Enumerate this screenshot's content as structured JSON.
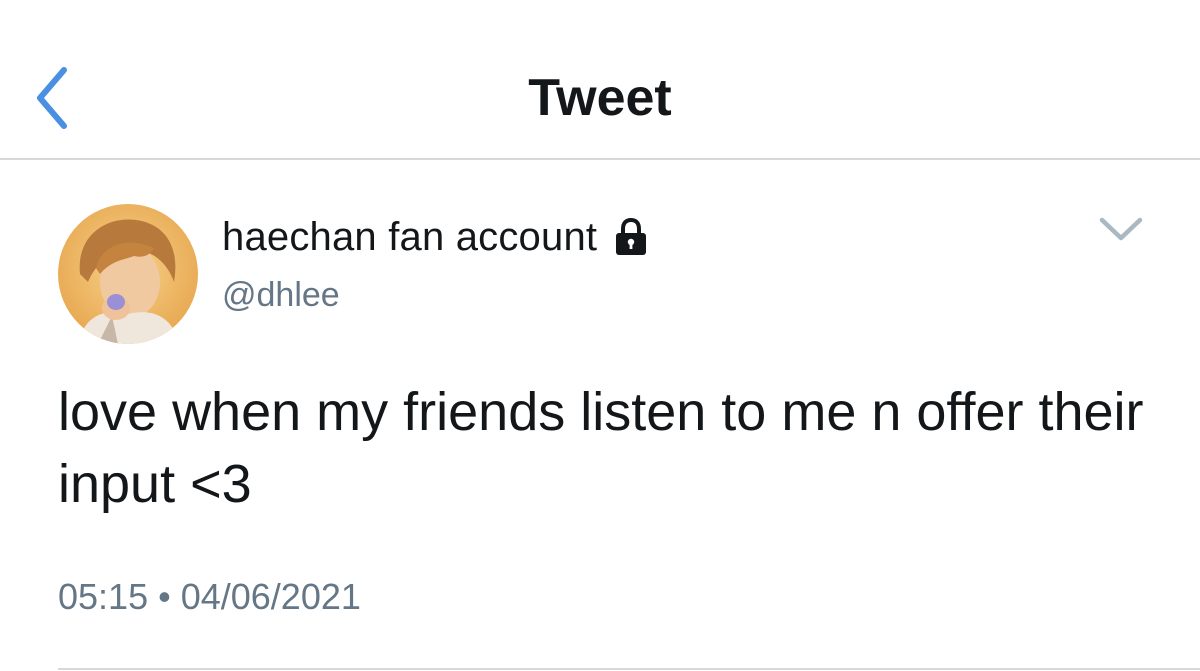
{
  "nav": {
    "title": "Tweet",
    "back_icon": "chevron-left-icon",
    "accent_color": "#4a90e2"
  },
  "tweet": {
    "author": {
      "display_name": "haechan fan account",
      "handle": "@dhlee",
      "protected_icon": "lock-icon"
    },
    "caret_icon": "chevron-down-icon",
    "text": "love when my friends listen to me n offer their input <3",
    "time": "05:15",
    "separator": "•",
    "date": "04/06/2021"
  },
  "colors": {
    "text_primary": "#14171a",
    "text_secondary": "#657786",
    "divider": "#d6d9dc"
  }
}
